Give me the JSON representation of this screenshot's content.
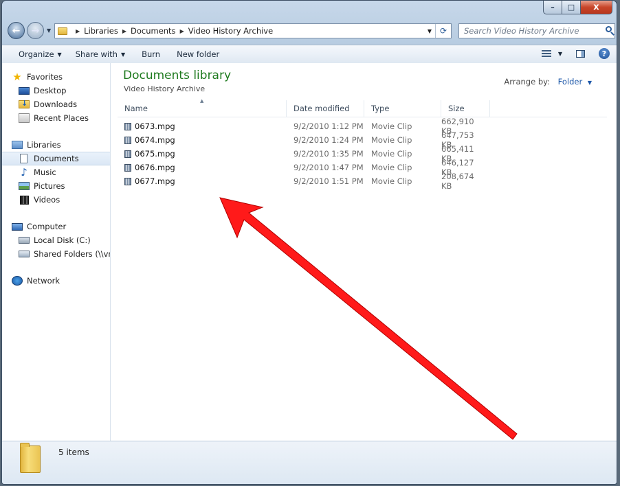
{
  "window": {
    "caption_minimize": "–",
    "caption_maximize": "□",
    "caption_close": "x"
  },
  "address_bar": {
    "breadcrumbs": [
      "Libraries",
      "Documents",
      "Video History Archive"
    ],
    "search_placeholder": "Search Video History Archive"
  },
  "toolbar": {
    "organize_label": "Organize",
    "share_label": "Share with",
    "burn_label": "Burn",
    "new_folder_label": "New folder"
  },
  "sidebar": {
    "favorites": {
      "label": "Favorites",
      "icon": "star-icon"
    },
    "favorites_items": [
      {
        "label": "Desktop",
        "icon": "desktop-icon"
      },
      {
        "label": "Downloads",
        "icon": "downloads-icon"
      },
      {
        "label": "Recent Places",
        "icon": "recent-places-icon"
      }
    ],
    "libraries": {
      "label": "Libraries",
      "icon": "libraries-icon"
    },
    "libraries_items": [
      {
        "label": "Documents",
        "icon": "document-icon",
        "selected": true
      },
      {
        "label": "Music",
        "icon": "music-icon"
      },
      {
        "label": "Pictures",
        "icon": "pictures-icon"
      },
      {
        "label": "Videos",
        "icon": "videos-icon"
      }
    ],
    "computer": {
      "label": "Computer",
      "icon": "computer-icon"
    },
    "computer_items": [
      {
        "label": "Local Disk (C:)",
        "icon": "disk-icon"
      },
      {
        "label": "Shared Folders (\\\\vn",
        "icon": "share-icon"
      }
    ],
    "network": {
      "label": "Network",
      "icon": "network-icon"
    }
  },
  "main": {
    "title": "Documents library",
    "subtitle": "Video History Archive",
    "arrange_label": "Arrange by:",
    "arrange_value": "Folder",
    "columns": {
      "name": "Name",
      "date": "Date modified",
      "type": "Type",
      "size": "Size"
    },
    "files": [
      {
        "name": "0673.mpg",
        "date": "9/2/2010 1:12 PM",
        "type": "Movie Clip",
        "size": "662,910 KB"
      },
      {
        "name": "0674.mpg",
        "date": "9/2/2010 1:24 PM",
        "type": "Movie Clip",
        "size": "647,753 KB"
      },
      {
        "name": "0675.mpg",
        "date": "9/2/2010 1:35 PM",
        "type": "Movie Clip",
        "size": "665,411 KB"
      },
      {
        "name": "0676.mpg",
        "date": "9/2/2010 1:47 PM",
        "type": "Movie Clip",
        "size": "646,127 KB"
      },
      {
        "name": "0677.mpg",
        "date": "9/2/2010 1:51 PM",
        "type": "Movie Clip",
        "size": "208,674 KB"
      }
    ]
  },
  "status": {
    "item_count": "5 items"
  },
  "annotation": {
    "arrow_color": "#ff1a1a"
  }
}
